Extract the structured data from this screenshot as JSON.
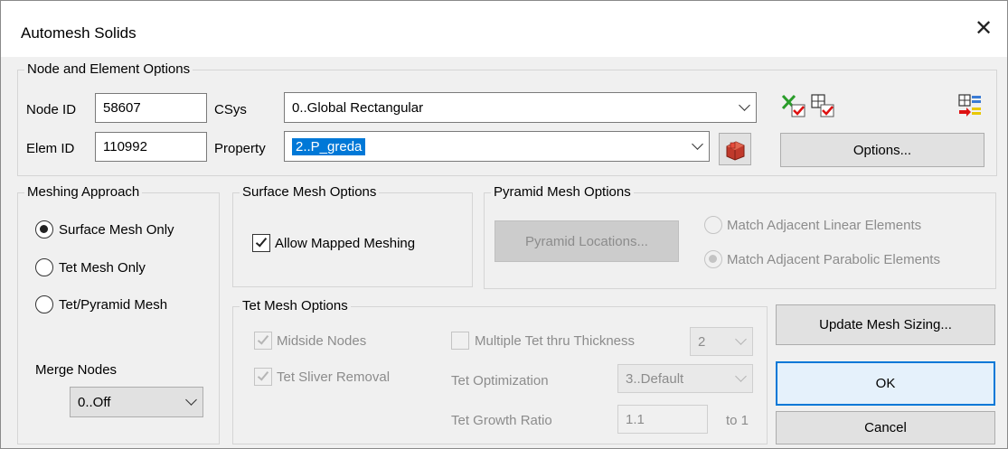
{
  "window": {
    "title": "Automesh Solids"
  },
  "node_element": {
    "legend": "Node and Element Options",
    "node_id_label": "Node ID",
    "node_id_value": "58607",
    "elem_id_label": "Elem ID",
    "elem_id_value": "110992",
    "csys_label": "CSys",
    "csys_value": "0..Global Rectangular",
    "property_label": "Property",
    "property_value": "2..P_greda",
    "options_button": "Options..."
  },
  "meshing_approach": {
    "legend": "Meshing Approach",
    "options": [
      "Surface Mesh Only",
      "Tet Mesh Only",
      "Tet/Pyramid Mesh"
    ],
    "selected": "Surface Mesh Only",
    "merge_nodes_label": "Merge Nodes",
    "merge_nodes_value": "0..Off"
  },
  "surface_mesh": {
    "legend": "Surface Mesh Options",
    "allow_mapped_label": "Allow Mapped Meshing",
    "allow_mapped_checked": true
  },
  "pyramid_mesh": {
    "legend": "Pyramid Mesh Options",
    "locations_button": "Pyramid Locations...",
    "match_linear_label": "Match Adjacent Linear Elements",
    "match_parabolic_label": "Match Adjacent Parabolic Elements",
    "selected": "Match Adjacent Parabolic Elements"
  },
  "tet_mesh": {
    "legend": "Tet Mesh Options",
    "midside_label": "Midside Nodes",
    "sliver_label": "Tet Sliver Removal",
    "multiple_label": "Multiple Tet thru Thickness",
    "multiple_value": "2",
    "optimization_label": "Tet Optimization",
    "optimization_value": "3..Default",
    "growth_label": "Tet Growth Ratio",
    "growth_value": "1.1",
    "growth_unit": "to 1"
  },
  "buttons": {
    "update_sizing": "Update Mesh Sizing...",
    "ok": "OK",
    "cancel": "Cancel"
  },
  "icons": {
    "close": "close-icon",
    "clear_all": "clear-all-check-icon",
    "mesh_check": "mesh-check-icon",
    "mesh_table": "mesh-table-icon",
    "property_picker": "property-picker-icon"
  }
}
